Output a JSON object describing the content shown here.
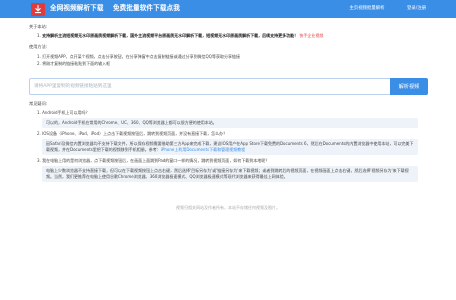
{
  "header": {
    "brand_title": "全网视频解析下载",
    "brand_subtitle": "免费批量软件下载点我",
    "nav": [
      "主页视频批量解析",
      "登录/注册"
    ],
    "accent_color": "#3a8ee6",
    "logo_color": "#e23b3b",
    "logo_icon": "download-icon"
  },
  "about": {
    "title": "关于本站:",
    "item_number": "1.",
    "item_bold": "支持解析主流短视频无水印原画质视频解析下载，国外主流视频平台原画质无水印解析下载，短视频无水印原画质解析下载，后续支持更多功能！",
    "item_red": "快手企业视频"
  },
  "usage": {
    "title": "使用方法:",
    "steps": [
      "1. 打开视频APP，点开某个视频，点击分享按钮，在分享弹窗中点击复制链接或通过分享到微信QQ等获取分享链接",
      "2. 将刚才复制的链接粘贴到下面的输入框"
    ]
  },
  "form": {
    "placeholder": "请将APP里复制的视频链接粘贴到这里",
    "value": "",
    "parse_button": "解析视频"
  },
  "faq": {
    "title": "常见疑问:",
    "items": [
      {
        "q": "1. Android手机上可以用吗？",
        "a": "可以的，Android手机在常用的Chrome、UC、360、QQ等浏览器上都可以很方便的使用本站。"
      },
      {
        "q": "2. IOS设备（iPhone、iPad、iPod）上点击下载视频按钮后，跳转到视频页面，并没有直接下载，怎么办？",
        "a": "因Safari及微信内置浏览器均不支持下载文件，所以保存视频需要借助第三方App来完成下载，建议IOS用户在App Store下载免费的Documents 6，然后在Documents的内置浏览器中使用本站，可以完美下载视频，并在Documents里把下载的视频移到手机相册。参考：",
        "link": "iPhone上利用Documents下载和管理视频教程"
      },
      {
        "q": "3. 我在电脑上用的是何浏览器，点下载视频按钮后，在画面上面跳到Pad的窗口一样的情况，跳转到视频页面，如何下载到本地呢？",
        "a": "电脑上少数浏览器不支持直接下载，但可以在下载视频按钮上点击右键，然后选择'目标另存为'或'链接另存为'来下载视频；或者到跳转后的视频页面，在视频画面上点击右键，然后选择'视频另存为'来下载视频。当然，我们更推荐在电脑上使用谷歌Chrome浏览器、360浏览器极速模式、QQ浏览器极速模式等现代浏览器来获得最佳上网体验。"
      }
    ]
  },
  "footer": {
    "disclaimer": "视频归相关网站及作者所有，本站不存储任何视频及图片。"
  }
}
